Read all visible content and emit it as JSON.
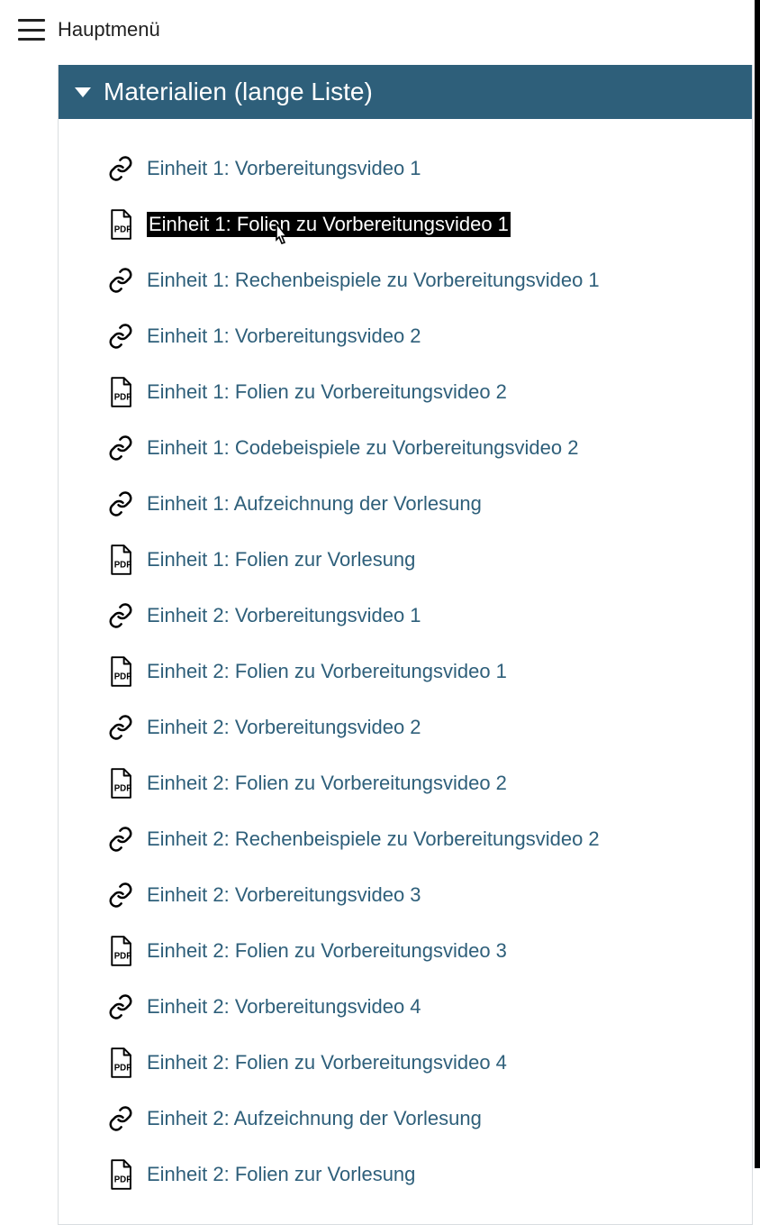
{
  "header": {
    "menu_label": "Hauptmenü"
  },
  "panel": {
    "title": "Materialien (lange Liste)"
  },
  "items": [
    {
      "type": "link",
      "label": "Einheit 1: Vorbereitungsvideo 1",
      "selected": false
    },
    {
      "type": "pdf",
      "label": "Einheit 1: Folien zu Vorbereitungsvideo 1",
      "selected": true
    },
    {
      "type": "link",
      "label": "Einheit 1: Rechenbeispiele zu Vorbereitungsvideo 1",
      "selected": false
    },
    {
      "type": "link",
      "label": "Einheit 1: Vorbereitungsvideo 2",
      "selected": false
    },
    {
      "type": "pdf",
      "label": "Einheit 1: Folien zu Vorbereitungsvideo 2",
      "selected": false
    },
    {
      "type": "link",
      "label": "Einheit 1: Codebeispiele zu Vorbereitungsvideo 2",
      "selected": false
    },
    {
      "type": "link",
      "label": "Einheit 1: Aufzeichnung der Vorlesung",
      "selected": false
    },
    {
      "type": "pdf",
      "label": "Einheit 1: Folien zur Vorlesung",
      "selected": false
    },
    {
      "type": "link",
      "label": "Einheit 2: Vorbereitungsvideo 1",
      "selected": false
    },
    {
      "type": "pdf",
      "label": "Einheit 2: Folien zu Vorbereitungsvideo 1",
      "selected": false
    },
    {
      "type": "link",
      "label": "Einheit 2: Vorbereitungsvideo 2",
      "selected": false
    },
    {
      "type": "pdf",
      "label": "Einheit 2: Folien zu Vorbereitungsvideo 2",
      "selected": false
    },
    {
      "type": "link",
      "label": "Einheit 2: Rechenbeispiele zu Vorbereitungsvideo 2",
      "selected": false
    },
    {
      "type": "link",
      "label": "Einheit 2: Vorbereitungsvideo 3",
      "selected": false
    },
    {
      "type": "pdf",
      "label": "Einheit 2: Folien zu Vorbereitungsvideo 3",
      "selected": false
    },
    {
      "type": "link",
      "label": "Einheit 2: Vorbereitungsvideo 4",
      "selected": false
    },
    {
      "type": "pdf",
      "label": "Einheit 2: Folien zu Vorbereitungsvideo 4",
      "selected": false
    },
    {
      "type": "link",
      "label": "Einheit 2: Aufzeichnung der Vorlesung",
      "selected": false
    },
    {
      "type": "pdf",
      "label": "Einheit 2: Folien zur Vorlesung",
      "selected": false
    }
  ]
}
